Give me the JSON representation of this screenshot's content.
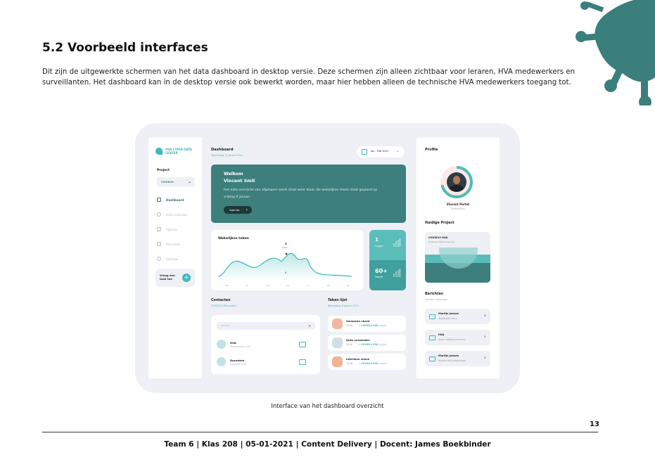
{
  "heading": "5.2 Voorbeeld interfaces",
  "intro": "Dit zijn de uitgewerkte schermen van het data dashboard in desktop versie. Deze schermen zijn alleen zichtbaar voor leraren, HVA medewerkers en surveillanten. Het dashboard kan in de desktop versie ook bewerkt worden, maar hier hebben alleen de technische HVA medewerkers toegang tot.",
  "colors": {
    "teal": "#3c7f7c",
    "accent": "#3fb8b8",
    "frame": "#eef0f5",
    "virus": "#3a7f7c"
  },
  "mockup": {
    "logo": "HVA COVID DATA CENTER",
    "project_label": "Project",
    "project_value": "COVID19",
    "nav": [
      "Dashboard",
      "Data analyses",
      "Agenda",
      "Berichten",
      "Settings"
    ],
    "help_text": "Vraag een taak toe",
    "dashboard_title": "Dashboard",
    "dashboard_date": "Woensdag, 6 januari 2021",
    "date_range": "Jan - Feb 2021",
    "welcome_line1": "Welkom",
    "welcome_line2": "Vincent Smit",
    "welcome_text": "Het data overzicht van afgelopen week staat weer klaar. De wekelijkse check staat gepland op vrijdag 8 januari",
    "agenda_button": "Agenda",
    "weekly_title": "Wekelijkse taken",
    "weekly_peak": "5",
    "weekly_peak_label": "taken",
    "weekly_low": "0",
    "weekly_days": [
      "Ma",
      "Di",
      "Wo",
      "Do",
      "Vr",
      "Za",
      "Zo"
    ],
    "stat1_value": "1",
    "stat1_label": "Vragen",
    "stat2_value": "60+",
    "stat2_label": "Gebied",
    "contacts_title": "Contacten",
    "contacts_sub": "COVID19 HVA project",
    "search_placeholder": "Search",
    "contacts": [
      {
        "name": "HVA",
        "sub": "Medewerkers HVA"
      },
      {
        "name": "Docenten",
        "sub": "Docenten HVA"
      }
    ],
    "tasks_title": "Taken lijst",
    "tasks_sub": "Woensdag, 6 januari 2021",
    "tasks": [
      {
        "name": "Sensoren check",
        "time": "10:30",
        "project": "COVID19 HVA",
        "suffix": "project",
        "color": "#f2b89f"
      },
      {
        "name": "Data verzenden",
        "time": "13:30",
        "project": "COVID19 HVA",
        "suffix": "project",
        "color": "#cfdfe5"
      },
      {
        "name": "Interface check",
        "time": "15:30",
        "project": "COVID19 HVA",
        "suffix": "project",
        "color": "#f0b394"
      }
    ],
    "profile_title": "Profile",
    "profile_name": "Vincent Portet",
    "profile_role": "Medewerker",
    "current_project_title": "Huidige Project",
    "current_project_name": "COVID19 HVA",
    "current_project_sub": "Sensoren Meldomgeving",
    "messages_title": "Berichten",
    "messages_sub": "Geleden Ontvangen",
    "messages": [
      {
        "name": "Martijn Jansen",
        "sub": "Registratie check"
      },
      {
        "name": "HVA",
        "sub": "Teams Meeting 8 januari"
      },
      {
        "name": "Martijn Jansen",
        "sub": "Nieuwe taak toegevoegd"
      }
    ]
  },
  "caption": "Interface van het dashboard overzicht",
  "page_number": "13",
  "footer": "Team 6 | Klas 208 | 05-01-2021 | Content Delivery | Docent: James Boekbinder"
}
